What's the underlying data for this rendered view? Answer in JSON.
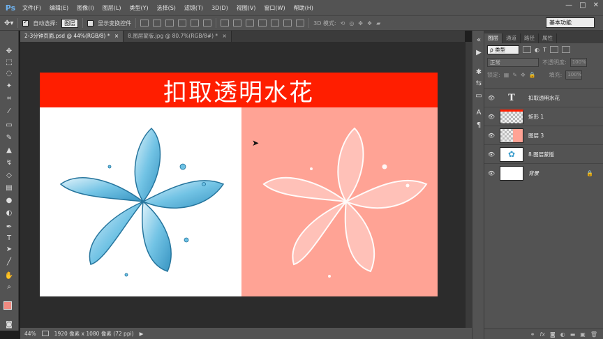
{
  "app": {
    "logo": "Ps"
  },
  "menu": [
    "文件(F)",
    "编辑(E)",
    "图像(I)",
    "图层(L)",
    "类型(Y)",
    "选择(S)",
    "滤镜(T)",
    "3D(D)",
    "视图(V)",
    "窗口(W)",
    "帮助(H)"
  ],
  "window_controls": {
    "minimize": "—",
    "maximize": "□",
    "close": "✕"
  },
  "options": {
    "auto_select_label": "自动选择:",
    "auto_select_value": "图层",
    "show_transform_label": "显示变换控件",
    "mode_3d_label": "3D 模式:",
    "workspace": "基本功能"
  },
  "doc_tabs": [
    {
      "label": "2-3分钟页面.psd @ 44%(RGB/8) *",
      "close": "×",
      "active": true
    },
    {
      "label": "8.图层蒙版.jpg @ 80.7%(RGB/8#) *",
      "close": "×",
      "active": false
    }
  ],
  "canvas": {
    "title": "扣取透明水花",
    "banner_color": "#ff1e00",
    "right_bg": "#ffa395"
  },
  "status": {
    "zoom": "44%",
    "doc_size": "1920 像素 x 1080 像素 (72 ppi)",
    "arrow": "▶"
  },
  "layers_panel": {
    "tabs": [
      "图层",
      "通道",
      "路径",
      "属性"
    ],
    "filter": "ρ 类型",
    "blend_mode": "正常",
    "opacity_label": "不透明度:",
    "opacity_value": "100%",
    "lock_label": "锁定:",
    "fill_label": "填充:",
    "fill_value": "100%",
    "layers": [
      {
        "name": "扣取透明水花",
        "type": "text",
        "thumb_text": "T"
      },
      {
        "name": "矩形 1",
        "type": "shape"
      },
      {
        "name": "图层 3",
        "type": "pixel"
      },
      {
        "name": "8.图层蒙版",
        "type": "image"
      },
      {
        "name": "背景",
        "type": "background"
      }
    ],
    "footer_icons": [
      "link-icon",
      "fx-icon",
      "mask-icon",
      "adjustment-icon",
      "group-icon",
      "new-layer-icon",
      "trash-icon"
    ]
  }
}
